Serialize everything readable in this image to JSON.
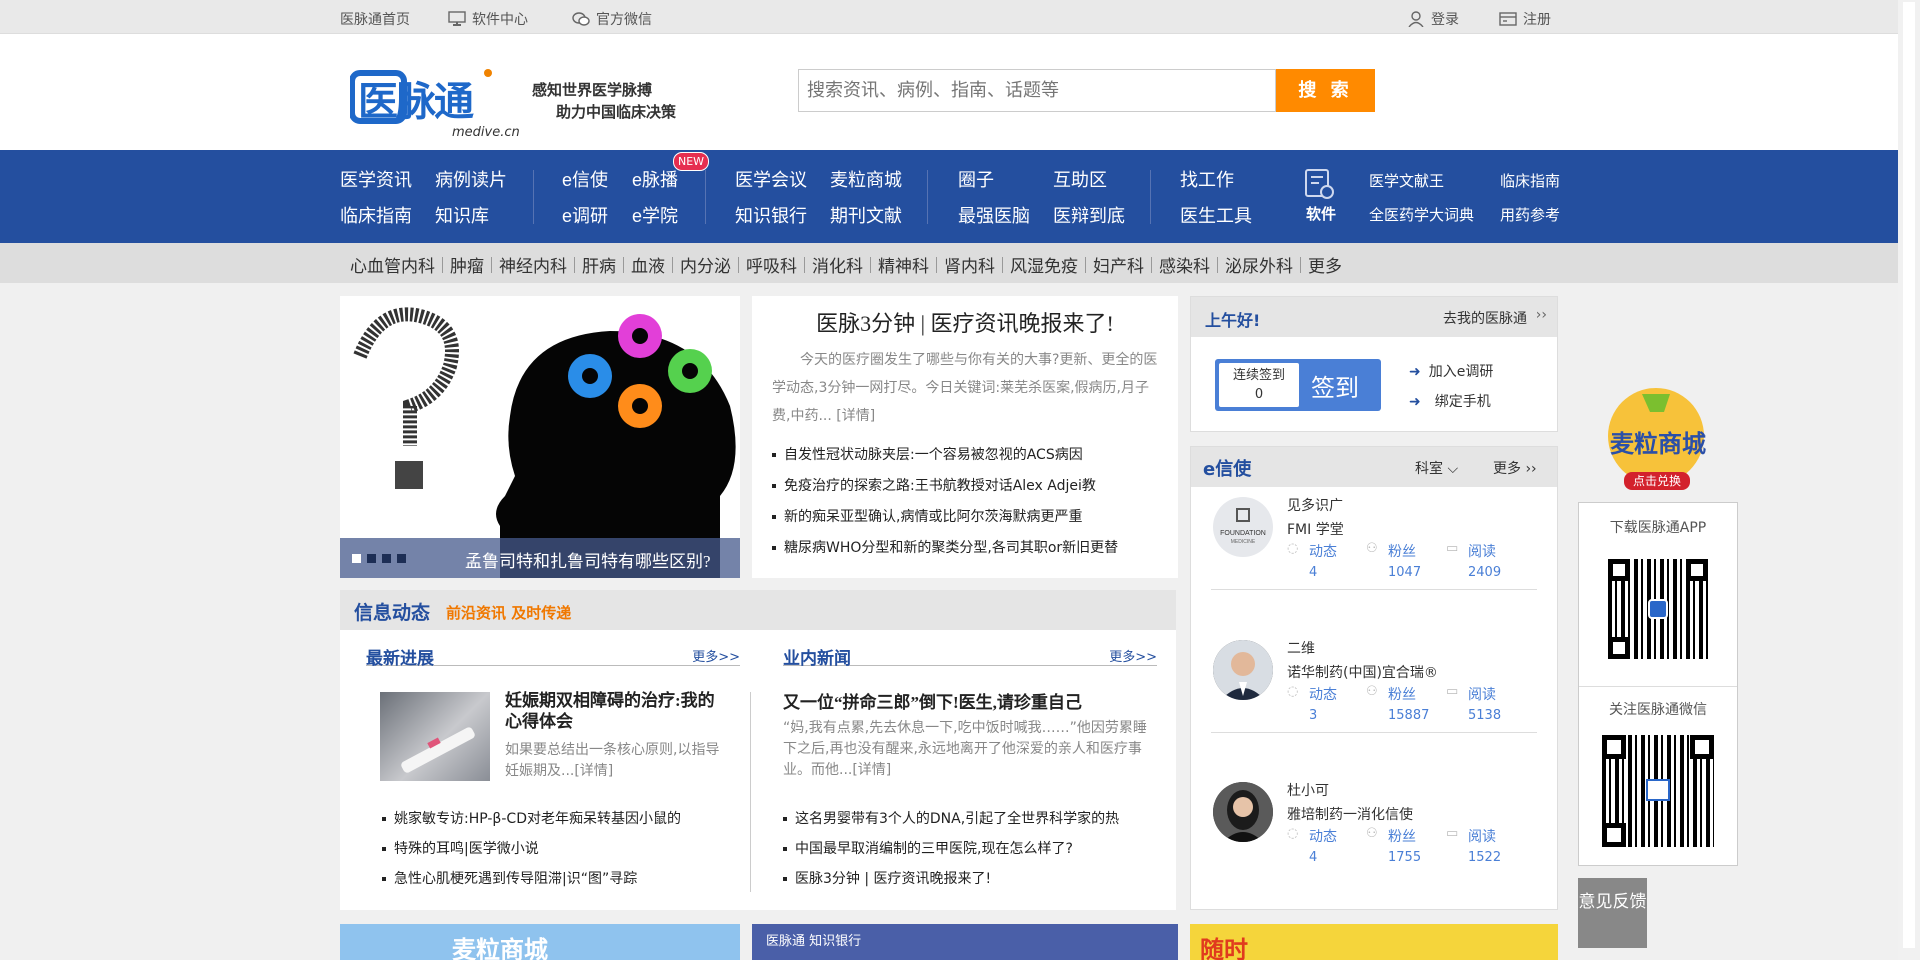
{
  "topbar": {
    "home": "医脉通首页",
    "software_center": "软件中心",
    "wechat": "官方微信",
    "login": "登录",
    "register": "注册"
  },
  "logo": {
    "brand": "医脉通",
    "domain": "medive.cn",
    "slogan_line1": "感知世界医学脉搏",
    "slogan_line2": "助力中国临床决策"
  },
  "search": {
    "placeholder": "搜索资讯、病例、指南、话题等",
    "button": "搜 索"
  },
  "nav": {
    "g1": [
      "医学资讯",
      "病例读片",
      "临床指南",
      "知识库"
    ],
    "g2": [
      "e信使",
      "e脉播",
      "e调研",
      "e学院"
    ],
    "new_badge": "NEW",
    "g3": [
      "医学会议",
      "麦粒商城",
      "知识银行",
      "期刊文献"
    ],
    "g4": [
      "圈子",
      "互助区",
      "最强医脑",
      "医辩到底"
    ],
    "g5": [
      "找工作",
      "医生工具"
    ],
    "software_label": "软件",
    "g6": [
      "医学文献王",
      "临床指南",
      "全医药学大词典",
      "用药参考"
    ]
  },
  "categories": [
    "心血管内科",
    "肿瘤",
    "神经内科",
    "肝病",
    "血液",
    "内分泌",
    "呼吸科",
    "消化科",
    "精神科",
    "肾内科",
    "风湿免疫",
    "妇产科",
    "感染科",
    "泌尿外科",
    "更多"
  ],
  "banner": {
    "caption": "孟鲁司特和扎鲁司特有哪些区别?"
  },
  "headline": {
    "title": "医脉3分钟 | 医疗资讯晚报来了!",
    "intro": "今天的医疗圈发生了哪些与你有关的大事?更新、更全的医学动态,3分钟一网打尽。今日关键词:莱芜杀医案,假病历,月子费,中药... [详情]",
    "items": [
      "自发性冠状动脉夹层:一个容易被忽视的ACS病因",
      "免疫治疗的探索之路:王书航教授对话Alex Adjei教",
      "新的痴呆亚型确认,病情或比阿尔茨海默病更严重",
      "糖尿病WHO分型和新的聚类分型,各司其职or新旧更替"
    ]
  },
  "greeting": {
    "title": "上午好!",
    "my_link": "去我的医脉通",
    "streak_label": "连续签到",
    "streak_count": "0",
    "signin": "签到",
    "join": "加入e调研",
    "bind_phone": "绑定手机"
  },
  "emessenger": {
    "title": "e信使",
    "dept": "科室",
    "more": "更多",
    "labels": {
      "dynamic": "动态",
      "fans": "粉丝",
      "read": "阅读"
    },
    "users": [
      {
        "name": "见多识广",
        "org": "FMI 学堂",
        "dynamic": "4",
        "fans": "1047",
        "read": "2409",
        "avatar": "foundation-medicine-logo"
      },
      {
        "name": "二维",
        "org": "诺华制药(中国)宜合瑞®",
        "dynamic": "3",
        "fans": "15887",
        "read": "5138",
        "avatar": "man-photo"
      },
      {
        "name": "杜小可",
        "org": "雅培制药一消化信使",
        "dynamic": "4",
        "fans": "1755",
        "read": "1522",
        "avatar": "woman-photo"
      }
    ]
  },
  "info": {
    "title": "信息动态",
    "subtitle": "前沿资讯 及时传递",
    "left": {
      "heading": "最新进展",
      "more": "更多>>",
      "feature_title": "妊娠期双相障碍的治疗:我的心得体会",
      "feature_text": "如果要总结出一条核心原则,以指导妊娠期及...[详情]",
      "items": [
        "姚家敏专访:HP-β-CD对老年痴呆转基因小鼠的",
        "特殊的耳鸣|医学微小说",
        "急性心肌梗死遇到传导阻滞|识“图”寻踪"
      ]
    },
    "right": {
      "heading": "业内新闻",
      "more": "更多>>",
      "feature_title": "又一位“拼命三郎”倒下!医生,请珍重自己",
      "feature_text": "“妈,我有点累,先去休息一下,吃中饭时喊我……”他因劳累睡下之后,再也没有醒来,永远地离开了他深爱的亲人和医疗事业。而他...[详情]",
      "items": [
        "这名男婴带有3个人的DNA,引起了全世界科学家的热",
        "中国最早取消编制的三甲医院,现在怎么样了?",
        "医脉3分钟 | 医疗资讯晚报来了!"
      ]
    }
  },
  "sidebar": {
    "mall_title": "麦粒商城",
    "mall_cta": "点击兑换",
    "download_app": "下载医脉通APP",
    "follow_wechat": "关注医脉通微信",
    "feedback": "意见反馈"
  },
  "bottom_ads": {
    "ad1": "麦粒商城",
    "ad2_brand": "医脉通 知识银行",
    "ad3": "随时"
  },
  "colors": {
    "nav_blue": "#244f9f",
    "search_orange": "#ff8a00",
    "badge_red": "#e62e50",
    "info_orange": "#f07800"
  }
}
